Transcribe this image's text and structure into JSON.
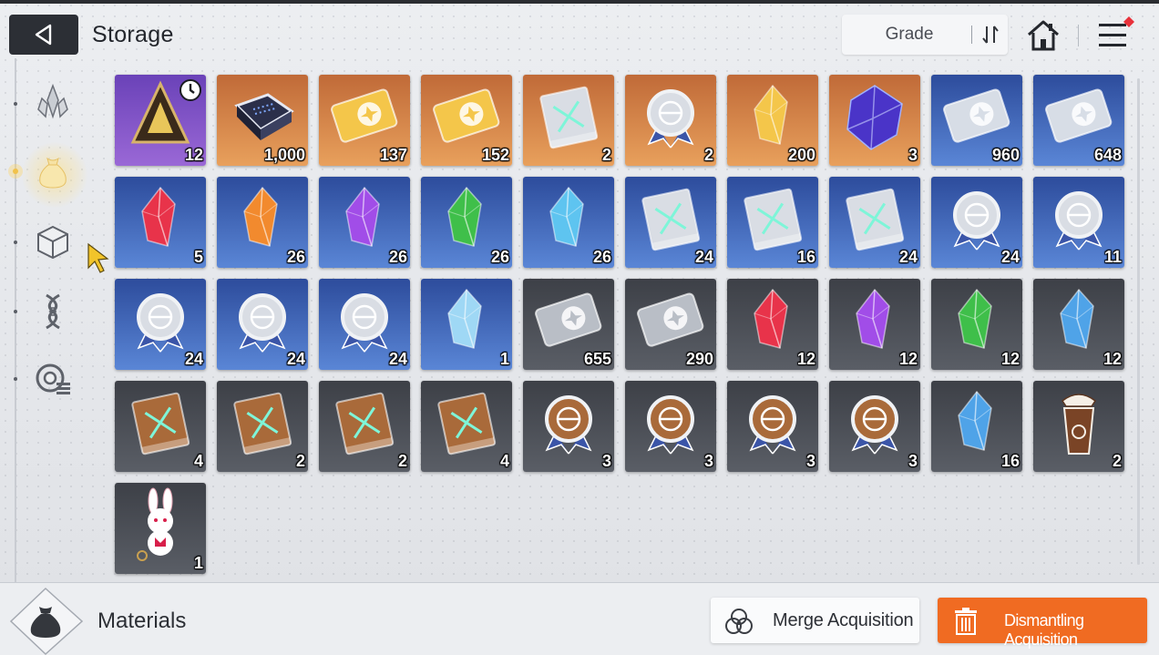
{
  "header": {
    "title": "Storage",
    "back_icon": "back-arrow-icon",
    "sort": {
      "label": "Grade",
      "icon": "sort-toggle-icon"
    },
    "home_icon": "home-icon",
    "menu_icon": "menu-icon",
    "menu_badge_color": "#e8313a"
  },
  "side_nav": {
    "items": [
      {
        "icon": "crystal-icon",
        "active": false
      },
      {
        "icon": "pouch-icon",
        "active": true
      },
      {
        "icon": "cube-icon",
        "active": false
      },
      {
        "icon": "dna-icon",
        "active": false
      },
      {
        "icon": "equipment-list-icon",
        "active": false
      }
    ]
  },
  "items": [
    {
      "icon": "prism-token-icon",
      "grade": "purple",
      "qty": "12",
      "timer": true
    },
    {
      "icon": "data-chip-icon",
      "grade": "orange",
      "qty": "1,000"
    },
    {
      "icon": "gold-ticket-icon",
      "grade": "orange",
      "qty": "137"
    },
    {
      "icon": "gold-star-ticket-icon",
      "grade": "orange",
      "qty": "152"
    },
    {
      "icon": "prism-manual-icon",
      "grade": "orange",
      "qty": "2"
    },
    {
      "icon": "medal-badge-icon",
      "grade": "orange",
      "qty": "2"
    },
    {
      "icon": "gold-shards-icon",
      "grade": "orange",
      "qty": "200"
    },
    {
      "icon": "dark-cube-icon",
      "grade": "orange",
      "qty": "3"
    },
    {
      "icon": "silver-ticket-icon",
      "grade": "blue",
      "qty": "960"
    },
    {
      "icon": "silver-star-ticket-icon",
      "grade": "blue",
      "qty": "648"
    },
    {
      "icon": "red-crystal-icon",
      "grade": "blue",
      "qty": "5"
    },
    {
      "icon": "orange-crystal-icon",
      "grade": "blue",
      "qty": "26"
    },
    {
      "icon": "purple-crystal-icon",
      "grade": "blue",
      "qty": "26"
    },
    {
      "icon": "green-crystal-icon",
      "grade": "blue",
      "qty": "26"
    },
    {
      "icon": "cyan-crystal-icon",
      "grade": "blue",
      "qty": "26"
    },
    {
      "icon": "sword-book-icon",
      "grade": "blue",
      "qty": "24"
    },
    {
      "icon": "shield-book-icon",
      "grade": "blue",
      "qty": "16"
    },
    {
      "icon": "bolt-book-icon",
      "grade": "blue",
      "qty": "24"
    },
    {
      "icon": "sword-badge-icon",
      "grade": "blue",
      "qty": "24"
    },
    {
      "icon": "shield-badge-icon",
      "grade": "blue",
      "qty": "11"
    },
    {
      "icon": "target-badge-icon",
      "grade": "blue",
      "qty": "24"
    },
    {
      "icon": "bolt-badge-icon",
      "grade": "blue",
      "qty": "24"
    },
    {
      "icon": "globe-badge-icon",
      "grade": "blue",
      "qty": "24"
    },
    {
      "icon": "ice-crystal-icon",
      "grade": "blue",
      "qty": "1"
    },
    {
      "icon": "gray-ticket-icon",
      "grade": "gray",
      "qty": "655"
    },
    {
      "icon": "gray-star-ticket-icon",
      "grade": "gray",
      "qty": "290"
    },
    {
      "icon": "red-shard-icon",
      "grade": "gray",
      "qty": "12"
    },
    {
      "icon": "purple-shard-icon",
      "grade": "gray",
      "qty": "12"
    },
    {
      "icon": "green-shard-icon",
      "grade": "gray",
      "qty": "12"
    },
    {
      "icon": "blue-shard-icon",
      "grade": "gray",
      "qty": "12"
    },
    {
      "icon": "bronze-sword-book-icon",
      "grade": "gray",
      "qty": "4"
    },
    {
      "icon": "bronze-shield-book-icon",
      "grade": "gray",
      "qty": "2"
    },
    {
      "icon": "bronze-target-book-icon",
      "grade": "gray",
      "qty": "2"
    },
    {
      "icon": "bronze-bolt-book-icon",
      "grade": "gray",
      "qty": "4"
    },
    {
      "icon": "bronze-sword-badge-icon",
      "grade": "gray",
      "qty": "3"
    },
    {
      "icon": "bronze-target-badge-icon",
      "grade": "gray",
      "qty": "3"
    },
    {
      "icon": "bronze-bolt-badge-icon",
      "grade": "gray",
      "qty": "3"
    },
    {
      "icon": "bronze-globe-badge-icon",
      "grade": "gray",
      "qty": "3"
    },
    {
      "icon": "blue-gem-icon",
      "grade": "gray",
      "qty": "16"
    },
    {
      "icon": "frappe-drink-icon",
      "grade": "gray",
      "qty": "2"
    },
    {
      "icon": "bunny-keychain-icon",
      "grade": "gray",
      "qty": "1"
    }
  ],
  "footer": {
    "category_icon": "materials-pouch-icon",
    "category_label": "Materials",
    "merge": {
      "label": "Merge Acquisition",
      "icon": "merge-icon"
    },
    "dismantle": {
      "label": "Dismantling Acquisition",
      "icon": "trash-icon",
      "color": "#f06b22"
    }
  }
}
